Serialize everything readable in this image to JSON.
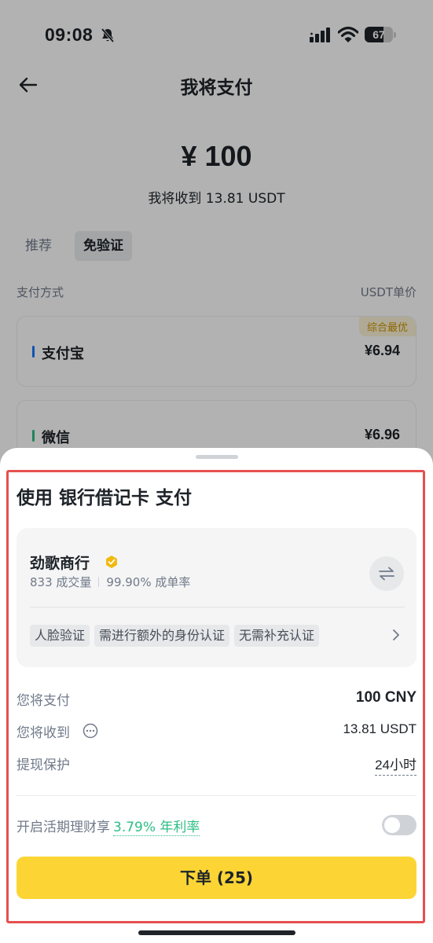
{
  "status": {
    "time": "09:08",
    "battery": "67",
    "battery_level": 0.67
  },
  "header": {
    "title": "我将支付"
  },
  "amount": {
    "value": "¥ 100",
    "receive_text": "我将收到 13.81 USDT"
  },
  "tabs": [
    {
      "label": "推荐"
    },
    {
      "label": "免验证"
    }
  ],
  "columns": {
    "left": "支付方式",
    "right": "USDT单价"
  },
  "methods": [
    {
      "name": "支付宝",
      "price": "¥6.94",
      "badge": "综合最优",
      "color": "#1677ff"
    },
    {
      "name": "微信",
      "price": "¥6.96",
      "color": "#2ebd85"
    }
  ],
  "sheet": {
    "title": "使用 银行借记卡 支付",
    "merchant": {
      "name": "劲歌商行",
      "trades": "833 成交量",
      "rate": "99.90% 成单率",
      "tags": [
        "人脸验证",
        "需进行额外的身份认证",
        "无需补充认证"
      ]
    },
    "rows": [
      {
        "label": "您将支付",
        "value": "100 CNY"
      },
      {
        "label": "您将收到",
        "value": "13.81 USDT"
      },
      {
        "label": "提现保护",
        "value": "24小时"
      }
    ],
    "earn": {
      "label": "开启活期理财享",
      "rate": "3.79% 年利率",
      "enabled": false
    },
    "order_button": "下单 (25)"
  },
  "colors": {
    "accent": "#fcd535",
    "positive": "#2ebd85",
    "highlight": "#e5504f"
  }
}
